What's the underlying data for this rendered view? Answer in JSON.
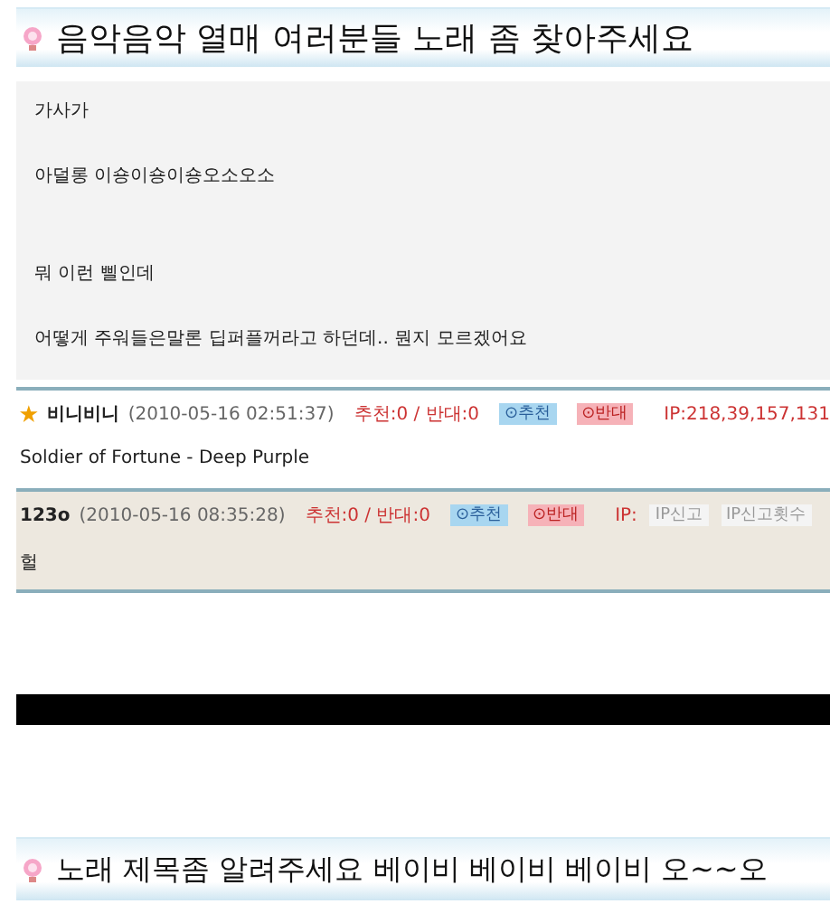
{
  "post": {
    "title": "음악음악 열매 여러분들 노래 좀 찾아주세요",
    "paragraphs": [
      [
        "가사가",
        "아덜롱 이숑이숑이숑오소오소"
      ],
      [
        "뭐 이런 삘인데",
        "어떻게 주워들은말론 딥퍼플꺼라고 하던데.. 뭔지 모르겠어요"
      ]
    ]
  },
  "comments": [
    {
      "author": "비니비니",
      "starred": true,
      "shaded": false,
      "date": "(2010-05-16 02:51:37)",
      "votes": "추천:0 / 반대:0",
      "up": "⊙추천",
      "down": "⊙반대",
      "ip": "IP:218,39,157,131",
      "body": "Soldier of Fortune - Deep Purple"
    },
    {
      "author": "123ο",
      "starred": false,
      "shaded": true,
      "date": "(2010-05-16 08:35:28)",
      "votes": "추천:0 / 반대:0",
      "up": "⊙추천",
      "down": "⊙반대",
      "ip": "IP:",
      "ip_actions": [
        "IP신고",
        "IP신고횟수"
      ],
      "body": "헐"
    }
  ],
  "next_post": {
    "title": "노래 제목좀 알려주세요 베이비 베이비 베이비 오~~오"
  }
}
